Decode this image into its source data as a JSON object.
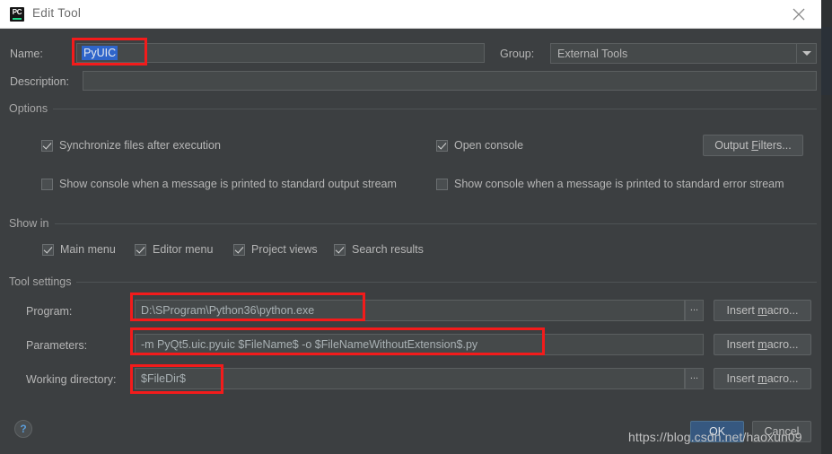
{
  "window": {
    "title": "Edit Tool",
    "icon": "pycharm-icon",
    "close_icon": "close-icon"
  },
  "form": {
    "name_label": "Name:",
    "name_value": "PyUIC",
    "group_label": "Group:",
    "group_value": "External Tools",
    "description_label": "Description:",
    "description_value": ""
  },
  "options": {
    "section_title": "Options",
    "checkboxes": [
      {
        "label": "Synchronize files after execution",
        "checked": true
      },
      {
        "label": "Open console",
        "checked": true
      },
      {
        "label": "Show console when a message is printed to standard output stream",
        "checked": false
      },
      {
        "label": "Show console when a message is printed to standard error stream",
        "checked": false
      }
    ],
    "output_filters_button": "Output Filters..."
  },
  "show_in": {
    "section_title": "Show in",
    "checkboxes": [
      {
        "label": "Main menu",
        "checked": true
      },
      {
        "label": "Editor menu",
        "checked": true
      },
      {
        "label": "Project views",
        "checked": true
      },
      {
        "label": "Search results",
        "checked": true
      }
    ]
  },
  "tool_settings": {
    "section_title": "Tool settings",
    "rows": [
      {
        "label": "Program:",
        "value": "D:\\SProgram\\Python36\\python.exe",
        "has_browse": true,
        "browse_label": "...",
        "macro_button": "Insert macro..."
      },
      {
        "label": "Parameters:",
        "value": "-m PyQt5.uic.pyuic  $FileName$ -o $FileNameWithoutExtension$.py",
        "has_browse": false,
        "browse_label": "",
        "macro_button": "Insert macro..."
      },
      {
        "label": "Working directory:",
        "value": "$FileDir$",
        "has_browse": true,
        "browse_label": "...",
        "macro_button": "Insert macro..."
      }
    ]
  },
  "footer": {
    "help_icon": "?",
    "ok_button": "OK",
    "cancel_button": "Cancel"
  },
  "watermark": {
    "text": "https://blog.csdn.net/haoxun09"
  },
  "colors": {
    "dialog_bg": "#3c3f41",
    "titlebar_bg": "#ffffff",
    "field_bg": "#45494a",
    "accent_primary": "#365880",
    "selection": "#2f65ca",
    "annotation_red": "#f31b1b"
  }
}
